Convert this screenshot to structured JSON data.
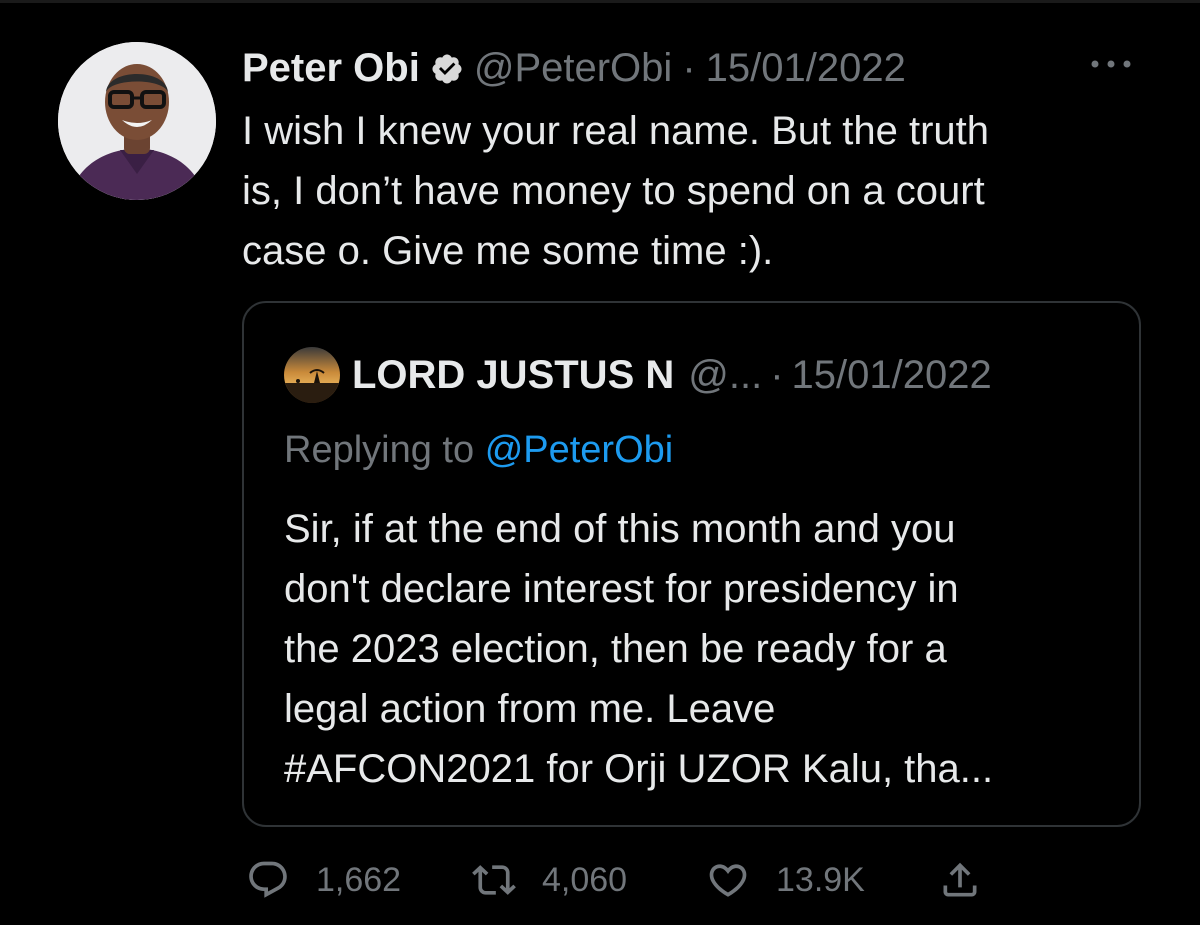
{
  "tweet": {
    "author": {
      "display_name": "Peter Obi",
      "verified": true,
      "handle": "@PeterObi",
      "avatar_icon": "profile-photo"
    },
    "separator": "·",
    "date": "15/01/2022",
    "text_lines": [
      "I wish I knew your real name. But the truth",
      "is, I don’t have money to spend on a court",
      "case o. Give me some time :)."
    ]
  },
  "quoted_tweet": {
    "author": {
      "display_name": "LORD JUSTUS N",
      "handle": "@...",
      "avatar_icon": "sunset-landscape-avatar"
    },
    "separator": "·",
    "date": "15/01/2022",
    "replying_prefix": "Replying to",
    "replying_to": "@PeterObi",
    "text_lines": [
      "Sir, if at the end of this month and you",
      "don't declare interest for presidency in",
      "the 2023 election, then be ready for a",
      "legal action from me. Leave",
      "#AFCON2021 for Orji UZOR Kalu, tha..."
    ]
  },
  "actions": {
    "reply": {
      "icon": "reply-icon",
      "count": "1,662"
    },
    "retweet": {
      "icon": "retweet-icon",
      "count": "4,060"
    },
    "like": {
      "icon": "heart-icon",
      "count": "13.9K"
    },
    "share": {
      "icon": "share-icon"
    }
  },
  "colors": {
    "background": "#000000",
    "text_primary": "#e7e9ea",
    "text_secondary": "#71767b",
    "link": "#1d9bf0",
    "border": "#2f3336"
  }
}
